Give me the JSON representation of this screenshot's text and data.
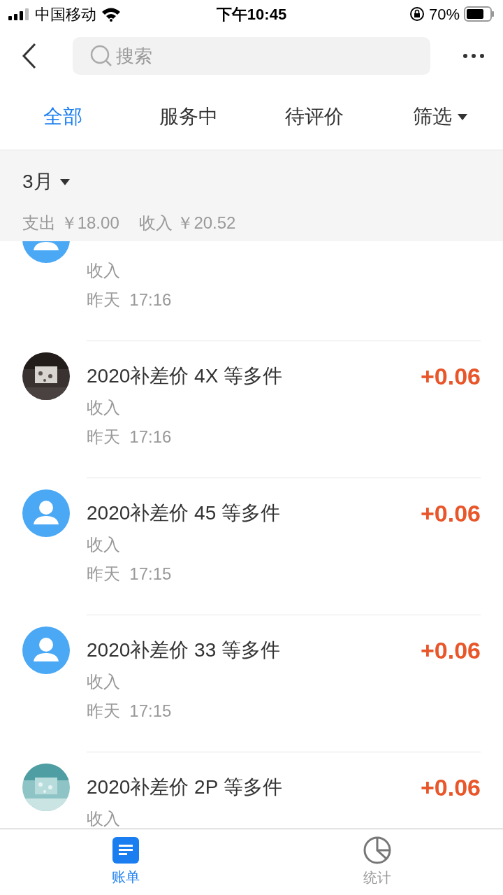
{
  "status_bar": {
    "carrier": "中国移动",
    "time": "下午10:45",
    "battery": "70%"
  },
  "search": {
    "placeholder": "搜索"
  },
  "tabs": [
    {
      "label": "全部",
      "selected": true,
      "kind": "tab"
    },
    {
      "label": "服务中",
      "selected": false,
      "kind": "tab"
    },
    {
      "label": "待评价",
      "selected": false,
      "kind": "tab"
    },
    {
      "label": "筛选",
      "selected": false,
      "kind": "filter"
    }
  ],
  "month": {
    "label": "3月",
    "expense_label": "支出",
    "expense": "￥18.00",
    "income_label": "收入",
    "income": "￥20.52"
  },
  "records": [
    {
      "type": "收入",
      "time": "昨天  17:16",
      "kind": "person"
    },
    {
      "title": "2020补差价 4X 等多件",
      "type": "收入",
      "time": "昨天  17:16",
      "amount": "+0.06",
      "kind": "picture"
    },
    {
      "title": "2020补差价 45 等多件",
      "type": "收入",
      "time": "昨天  17:15",
      "amount": "+0.06",
      "kind": "person"
    },
    {
      "title": "2020补差价 33 等多件",
      "type": "收入",
      "time": "昨天  17:15",
      "amount": "+0.06",
      "kind": "person"
    },
    {
      "title": "2020补差价 2P 等多件",
      "type": "收入",
      "amount": "+0.06",
      "kind": "picture"
    }
  ],
  "bottom_tabs": [
    {
      "label": "账单",
      "selected": true,
      "kind": "bill"
    },
    {
      "label": "统计",
      "selected": false,
      "kind": "stats"
    }
  ]
}
